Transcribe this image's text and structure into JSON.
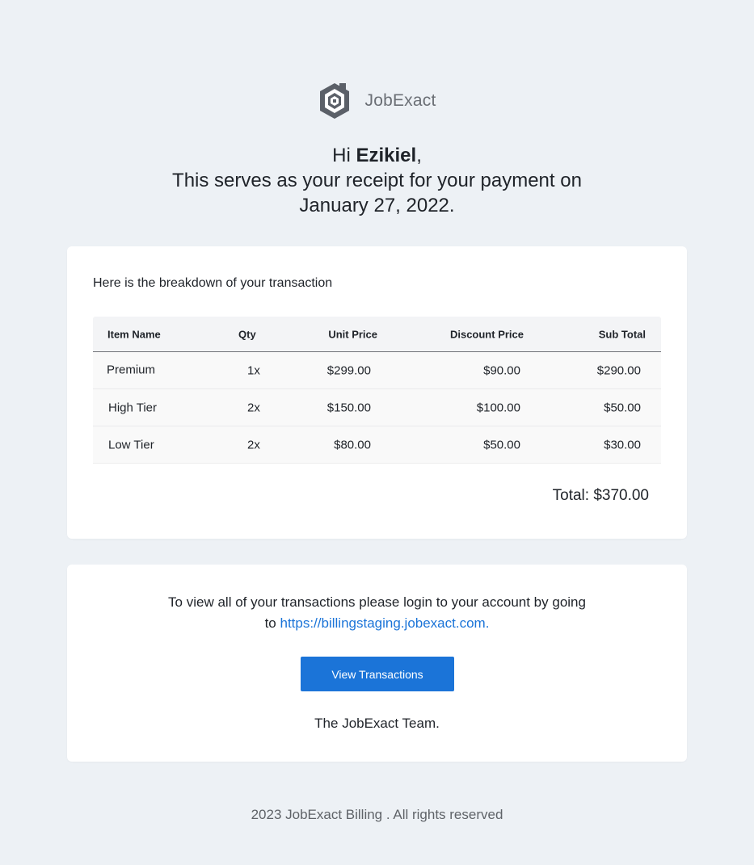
{
  "brand": {
    "name": "JobExact",
    "logo_icon": "hexagon-house-logo-icon",
    "logo_color": "#5b6068"
  },
  "greeting": {
    "salutation": "Hi",
    "name": "Ezikiel",
    "comma": ",",
    "line2": "This serves as your receipt for your payment on",
    "line3": "January 27, 2022."
  },
  "breakdown": {
    "title": "Here is the breakdown of your transaction",
    "columns": [
      "Item Name",
      "Qty",
      "Unit Price",
      "Discount Price",
      "Sub Total"
    ],
    "rows": [
      [
        "Premium",
        "1x",
        "$299.00",
        "$90.00",
        "$290.00"
      ],
      [
        "High Tier",
        "2x",
        "$150.00",
        "$100.00",
        "$50.00"
      ],
      [
        "Low Tier",
        "2x",
        "$80.00",
        "$50.00",
        "$30.00"
      ]
    ],
    "total": "Total: $370.00"
  },
  "info": {
    "text": "To view all of your transactions please login to your account by going",
    "text_to": "to",
    "link": "https://billingstaging.jobexact.com.",
    "button_label": "View Transactions",
    "signoff": "The JobExact Team."
  },
  "footer": {
    "text": "2023 JobExact Billing . All rights reserved"
  },
  "colors": {
    "background": "#edf1f5",
    "accent": "#1b74d8",
    "card": "#ffffff"
  }
}
